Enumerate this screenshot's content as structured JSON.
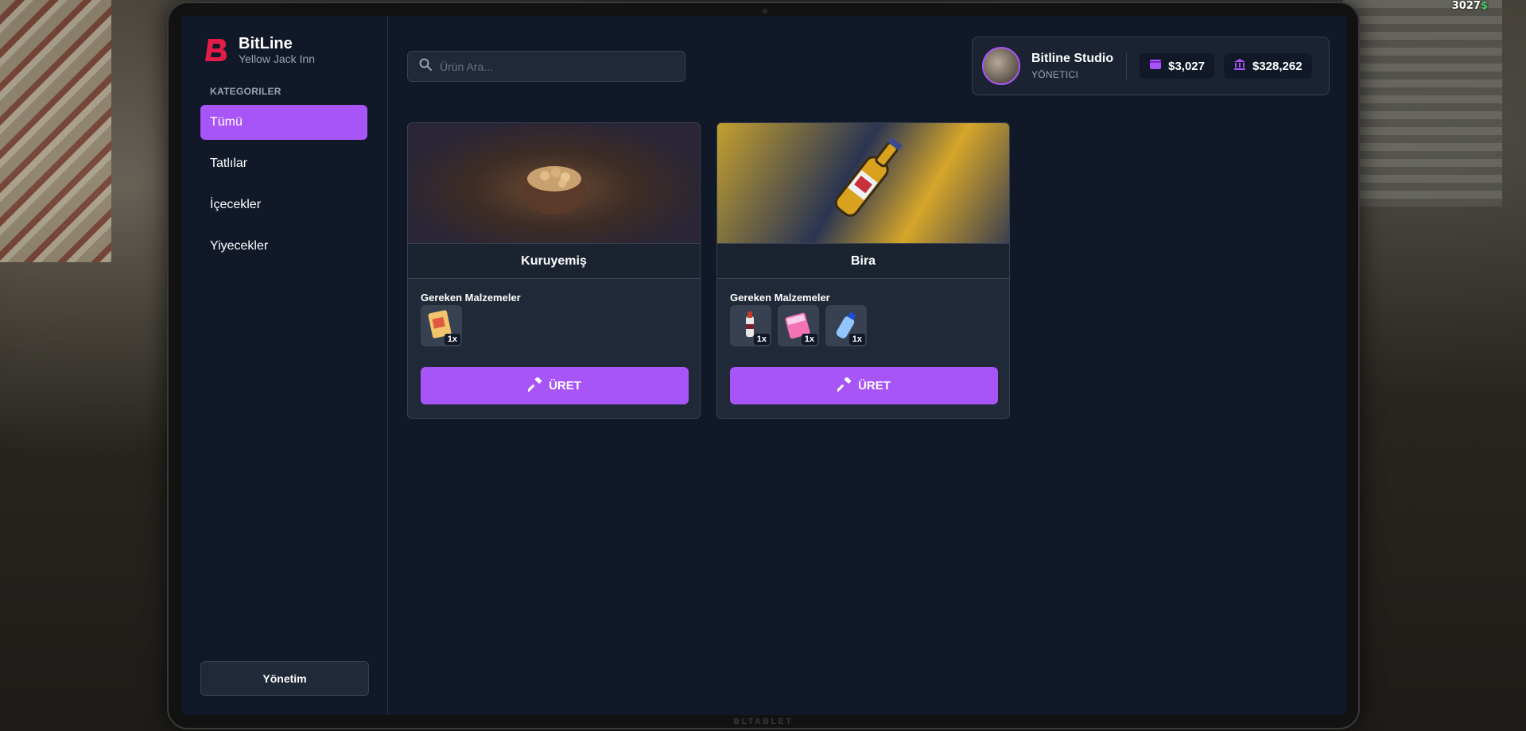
{
  "hud": {
    "money": "3027",
    "currency_symbol": "$"
  },
  "tablet": {
    "brand_mark": "BLTABLET"
  },
  "sidebar": {
    "brand_title": "BitLine",
    "brand_subtitle": "Yellow Jack Inn",
    "category_heading": "KATEGORILER",
    "categories": [
      {
        "label": "Tümü",
        "active": true
      },
      {
        "label": "Tatlılar",
        "active": false
      },
      {
        "label": "İçecekler",
        "active": false
      },
      {
        "label": "Yiyecekler",
        "active": false
      }
    ],
    "management_label": "Yönetim"
  },
  "search": {
    "placeholder": "Ürün Ara..."
  },
  "profile": {
    "name": "Bitline Studio",
    "role": "YÖNETICI",
    "cash": "$3,027",
    "bank": "$328,262"
  },
  "products": [
    {
      "name": "Kuruyemiş",
      "requirements_label": "Gereken Malzemeler",
      "materials": [
        {
          "icon": "snack-bag-icon",
          "qty": "1x"
        }
      ],
      "button_label": "ÜRET"
    },
    {
      "name": "Bira",
      "requirements_label": "Gereken Malzemeler",
      "materials": [
        {
          "icon": "bottle-icon",
          "qty": "1x"
        },
        {
          "icon": "pink-package-icon",
          "qty": "1x"
        },
        {
          "icon": "water-bottle-icon",
          "qty": "1x"
        }
      ],
      "button_label": "ÜRET"
    }
  ],
  "colors": {
    "accent": "#a855f7",
    "screen_bg": "#111827",
    "card_bg": "#1f2937",
    "logo_red": "#e11d48"
  }
}
